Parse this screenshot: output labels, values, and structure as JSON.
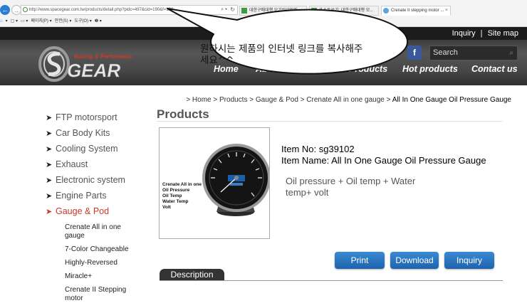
{
  "browser": {
    "url": "http://www.spacegear.com.tw/products/detail.php?pidc=497&cid=190&f=139",
    "address_search_icon": "⌕ ▾",
    "refresh_icon": "↻",
    "tabs": [
      {
        "label": "대한구매대행 모기바이맛집 ..."
      },
      {
        "label": "포스트쓰기: 대한구매대행 모..."
      },
      {
        "label": "Crenate II stepping motor ..."
      }
    ],
    "tab_close": "×",
    "command_bar": [
      "▾",
      "▢ ▾",
      "▭ ▾",
      "페이지(P) ▾",
      "안전(S) ▾",
      "도구(O) ▾",
      "❷ ▾"
    ],
    "back_icon": "←",
    "forward_icon": "→"
  },
  "header": {
    "top_links": {
      "inquiry": "Inquiry",
      "separator": "|",
      "site_map": "Site map"
    },
    "logo": {
      "tagline": "Racing & Performance",
      "wordmark": "GEAR"
    },
    "nav": [
      "Home",
      "About us",
      "News",
      "Products",
      "Hot products",
      "Contact us"
    ],
    "social": [
      {
        "name": "youtube",
        "label": "You Tube",
        "color": "#c4302b"
      },
      {
        "name": "facebook",
        "label": "f",
        "color": "#3b5998"
      }
    ],
    "search": {
      "placeholder": "Search",
      "icon": "⌕"
    }
  },
  "callout": {
    "text": "원하시는 제품의 인터넷 링크를 복사해주세요^^"
  },
  "breadcrumb": {
    "prefix": "> Home > Products > Gauge & Pod > Crenate All in one gauge > ",
    "current": "All In One Gauge Oil Pressure Gauge"
  },
  "page_title": "Products",
  "sidebar": {
    "arrow": "➤",
    "categories": [
      {
        "label": "FTP motorsport",
        "active": false
      },
      {
        "label": "Car Body Kits",
        "active": false
      },
      {
        "label": "Cooling System",
        "active": false
      },
      {
        "label": "Exhaust",
        "active": false
      },
      {
        "label": "Electronic system",
        "active": false
      },
      {
        "label": "Engine Parts",
        "active": false
      },
      {
        "label": "Gauge & Pod",
        "active": true
      }
    ],
    "subcategories": [
      "Crenate All in one gauge",
      "7-Color Changeable",
      "Highly-Reversed",
      "Miracle+",
      "Crenate II Stepping motor"
    ]
  },
  "product": {
    "image_labels": [
      "Crenate All in one",
      "Oil Pressure",
      "Oil Temp",
      "Water Temp",
      "Volt"
    ],
    "item_no": "Item No: sg39102",
    "item_name": "Item Name: All In One Gauge Oil Pressure Gauge",
    "description": "Oil pressure + Oil temp + Water temp+ volt"
  },
  "actions": {
    "print": "Print",
    "download": "Download",
    "inquiry": "Inquiry"
  },
  "tabs": {
    "description": "Description"
  },
  "colors": {
    "accent_blue": "#2a74c2",
    "active_category": "#c8382a",
    "header_dark": "#1c1c1c"
  }
}
